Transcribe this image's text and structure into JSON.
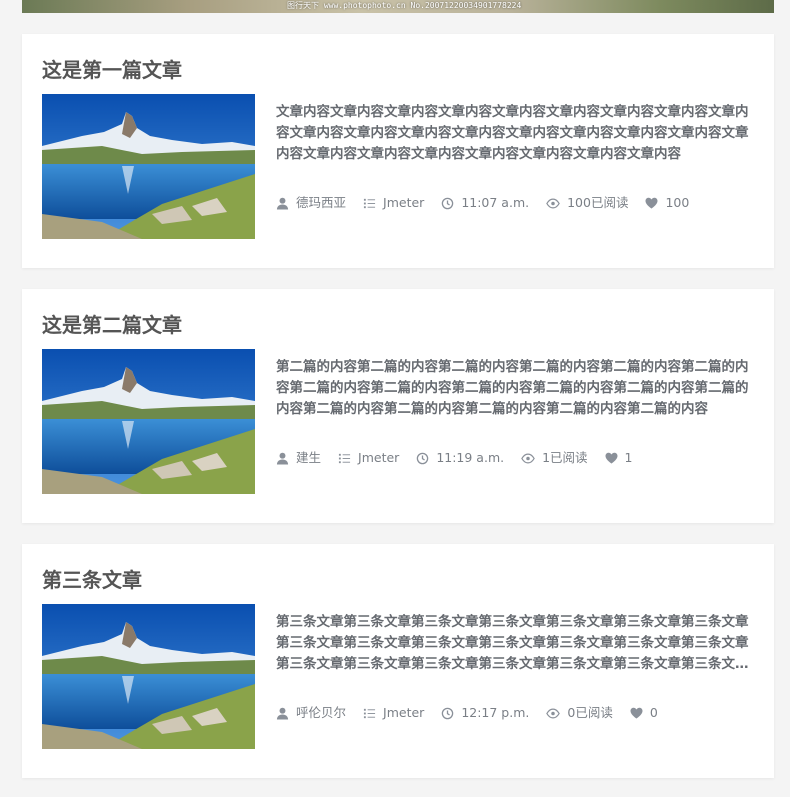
{
  "banner": {
    "watermark": "图行天下 www.photophoto.cn  No.20071220034901778224"
  },
  "posts": [
    {
      "title": "这是第一篇文章",
      "excerpt": "文章内容文章内容文章内容文章内容文章内容文章内容文章内容文章内容文章内容文章内容文章内容文章内容文章内容文章内容文章内容文章内容文章内容文章内容文章内容文章内容文章内容文章内容文章内容文章内容文章内容",
      "author": "德玛西亚",
      "category": "Jmeter",
      "time": "11:07 a.m.",
      "views": "100已阅读",
      "likes": "100"
    },
    {
      "title": "这是第二篇文章",
      "excerpt": "第二篇的内容第二篇的内容第二篇的内容第二篇的内容第二篇的内容第二篇的内容第二篇的内容第二篇的内容第二篇的内容第二篇的内容第二篇的内容第二篇的内容第二篇的内容第二篇的内容第二篇的内容第二篇的内容第二篇的内容",
      "author": "建生",
      "category": "Jmeter",
      "time": "11:19 a.m.",
      "views": "1已阅读",
      "likes": "1"
    },
    {
      "title": "第三条文章",
      "excerpt": "第三条文章第三条文章第三条文章第三条文章第三条文章第三条文章第三条文章第三条文章第三条文章第三条文章第三条文章第三条文章第三条文章第三条文章第三条文章第三条文章第三条文章第三条文章第三条文章第三条文章第三条文章第三条文章",
      "author": "呼伦贝尔",
      "category": "Jmeter",
      "time": "12:17 p.m.",
      "views": "0已阅读",
      "likes": "0"
    }
  ],
  "icons": {
    "author": "user-icon",
    "category": "list-icon",
    "time": "clock-icon",
    "views": "eye-icon",
    "likes": "heart-icon"
  },
  "colors": {
    "background": "#f4f4f4",
    "card": "#ffffff",
    "title": "#555555",
    "meta": "#7a7f86"
  }
}
